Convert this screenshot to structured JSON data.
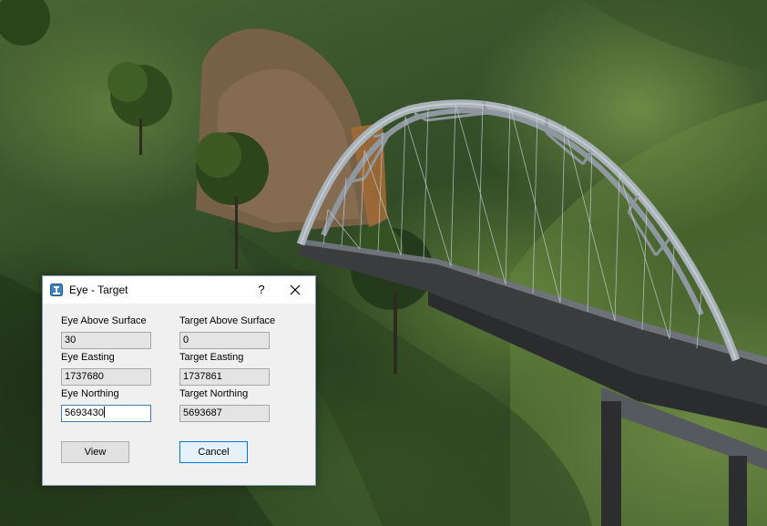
{
  "dialog": {
    "title": "Eye - Target",
    "help_label": "?",
    "icons": {
      "app": "station-icon",
      "close": "close-icon"
    }
  },
  "fields": {
    "eye_above_surface": {
      "label": "Eye Above Surface",
      "value": "30"
    },
    "target_above_surface": {
      "label": "Target Above Surface",
      "value": "0"
    },
    "eye_easting": {
      "label": "Eye Easting",
      "value": "1737680"
    },
    "target_easting": {
      "label": "Target Easting",
      "value": "1737861"
    },
    "eye_northing": {
      "label": "Eye Northing",
      "value": "5693430"
    },
    "target_northing": {
      "label": "Target Northing",
      "value": "5693687"
    }
  },
  "buttons": {
    "view": "View",
    "cancel": "Cancel"
  },
  "colors": {
    "accent": "#0078d7",
    "dialog_bg": "#f0f0f0",
    "bridge_steel": "#9aa3ad"
  }
}
